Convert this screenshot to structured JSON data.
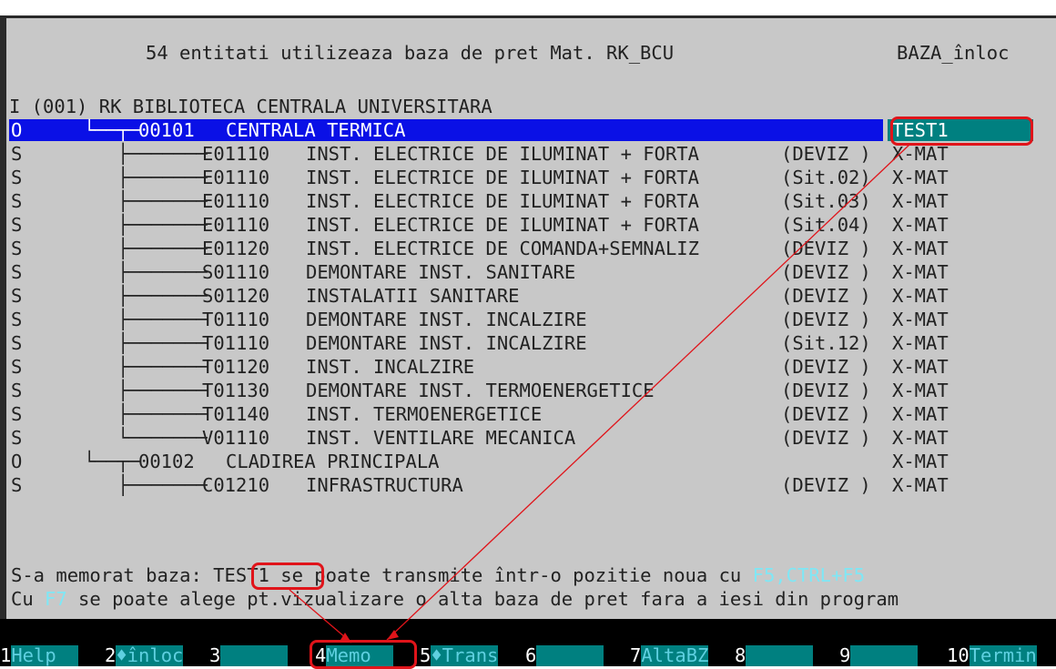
{
  "header": {
    "title": "54 entitati utilizeaza baza de pret Mat. RK_BCU",
    "mode": "BAZA_înloc"
  },
  "tree": {
    "root": "I (001) RK BIBLIOTECA CENTRALA UNIVERSITARA",
    "rows": [
      {
        "type": "O",
        "branch": "└──┬─",
        "code": "00101",
        "name": "CENTRALA TERMICA",
        "sit": "",
        "base": "TEST1"
      },
      {
        "type": "S",
        "branch": "   ├───────",
        "code": "E01110",
        "name": "INST. ELECTRICE DE ILUMINAT + FORTA",
        "sit": "(DEVIZ )",
        "base": "X-MAT"
      },
      {
        "type": "S",
        "branch": "   ├───────",
        "code": "E01110",
        "name": "INST. ELECTRICE DE ILUMINAT + FORTA",
        "sit": "(Sit.02)",
        "base": "X-MAT"
      },
      {
        "type": "S",
        "branch": "   ├───────",
        "code": "E01110",
        "name": "INST. ELECTRICE DE ILUMINAT + FORTA",
        "sit": "(Sit.03)",
        "base": "X-MAT"
      },
      {
        "type": "S",
        "branch": "   ├───────",
        "code": "E01110",
        "name": "INST. ELECTRICE DE ILUMINAT + FORTA",
        "sit": "(Sit.04)",
        "base": "X-MAT"
      },
      {
        "type": "S",
        "branch": "   ├───────",
        "code": "E01120",
        "name": "INST. ELECTRICE DE COMANDA+SEMNALIZ",
        "sit": "(DEVIZ )",
        "base": "X-MAT"
      },
      {
        "type": "S",
        "branch": "   ├───────",
        "code": "S01110",
        "name": "DEMONTARE INST. SANITARE",
        "sit": "(DEVIZ )",
        "base": "X-MAT"
      },
      {
        "type": "S",
        "branch": "   ├───────",
        "code": "S01120",
        "name": "INSTALATII SANITARE",
        "sit": "(DEVIZ )",
        "base": "X-MAT"
      },
      {
        "type": "S",
        "branch": "   ├───────",
        "code": "T01110",
        "name": "DEMONTARE INST. INCALZIRE",
        "sit": "(DEVIZ )",
        "base": "X-MAT"
      },
      {
        "type": "S",
        "branch": "   ├───────",
        "code": "T01110",
        "name": "DEMONTARE INST. INCALZIRE",
        "sit": "(Sit.12)",
        "base": "X-MAT"
      },
      {
        "type": "S",
        "branch": "   ├───────",
        "code": "T01120",
        "name": "INST. INCALZIRE",
        "sit": "(DEVIZ )",
        "base": "X-MAT"
      },
      {
        "type": "S",
        "branch": "   ├───────",
        "code": "T01130",
        "name": "DEMONTARE INST. TERMOENERGETICE",
        "sit": "(DEVIZ )",
        "base": "X-MAT"
      },
      {
        "type": "S",
        "branch": "   ├───────",
        "code": "T01140",
        "name": "INST. TERMOENERGETICE",
        "sit": "(DEVIZ )",
        "base": "X-MAT"
      },
      {
        "type": "S",
        "branch": "   └───────",
        "code": "V01110",
        "name": "INST. VENTILARE MECANICA",
        "sit": "(DEVIZ )",
        "base": "X-MAT"
      },
      {
        "type": "O",
        "branch": "└──┬─",
        "code": "00102",
        "name": "CLADIREA PRINCIPALA",
        "sit": "",
        "base": "X-MAT"
      },
      {
        "type": "S",
        "branch": "   ├───────",
        "code": "C01210",
        "name": "INFRASTRUCTURA",
        "sit": "(DEVIZ )",
        "base": "X-MAT"
      }
    ]
  },
  "status": {
    "line1_prefix": "S-a memorat baza:",
    "line1_base": "TEST1",
    "line1_mid": " se poate transmite într-o pozitie noua cu ",
    "line1_keys": "F5,CTRL+F5",
    "line2_prefix": "Cu ",
    "line2_key": "F7",
    "line2_rest": " se poate alege pt.vizualizare o alta baza de pret fara a iesi din program"
  },
  "fkeys": [
    {
      "num": "1",
      "label": "Help  "
    },
    {
      "num": "2",
      "label": "♦înloc"
    },
    {
      "num": "3",
      "label": "      "
    },
    {
      "num": "4",
      "label": "Memo  "
    },
    {
      "num": "5",
      "label": "♦Trans"
    },
    {
      "num": "6",
      "label": "      "
    },
    {
      "num": "7",
      "label": "AltaBZ"
    },
    {
      "num": "8",
      "label": "      "
    },
    {
      "num": "9",
      "label": "      "
    },
    {
      "num": "10",
      "label": "Termin"
    }
  ],
  "colors": {
    "background": "#c8c8c8",
    "highlight": "#0a10e6",
    "teal": "#008080",
    "annotation": "#e0141a"
  }
}
